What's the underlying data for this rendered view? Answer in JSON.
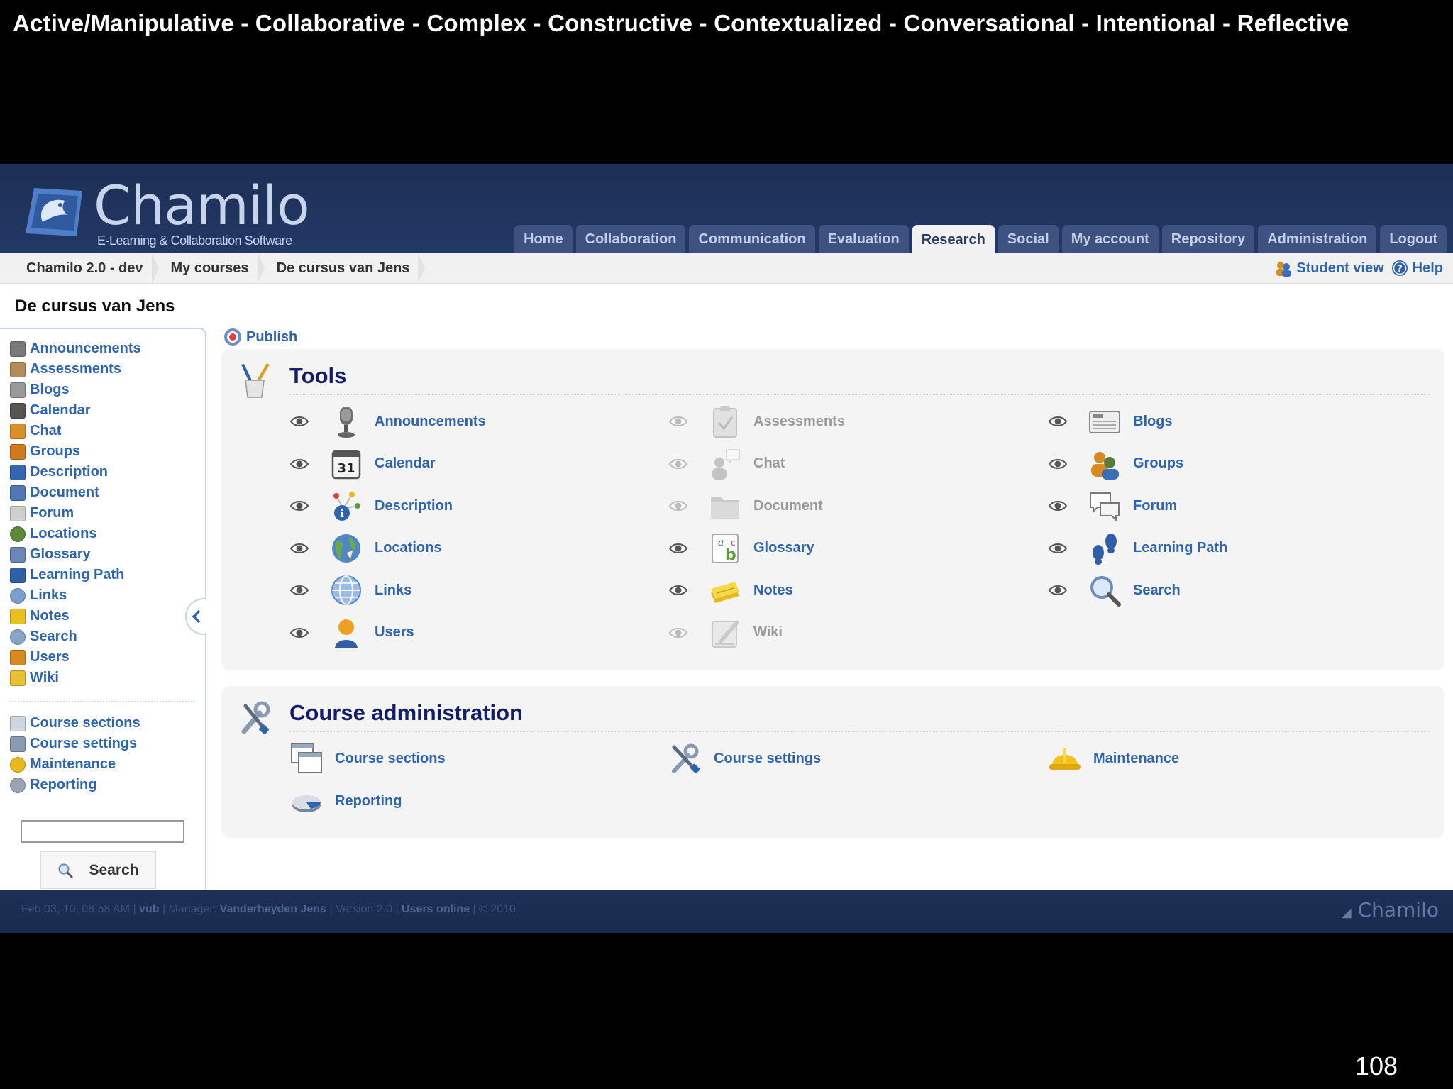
{
  "slide": {
    "title": "Active/Manipulative - Collaborative - Complex - Constructive - Contextualized - Conversational - Intentional - Reflective",
    "page_number": "108"
  },
  "header": {
    "logo_text": "Chamilo",
    "logo_sub": "E-Learning & Collaboration Software",
    "tabs": [
      {
        "label": "Home",
        "active": false
      },
      {
        "label": "Collaboration",
        "active": false
      },
      {
        "label": "Communication",
        "active": false
      },
      {
        "label": "Evaluation",
        "active": false
      },
      {
        "label": "Research",
        "active": true
      },
      {
        "label": "Social",
        "active": false
      },
      {
        "label": "My account",
        "active": false
      },
      {
        "label": "Repository",
        "active": false
      },
      {
        "label": "Administration",
        "active": false
      },
      {
        "label": "Logout",
        "active": false
      }
    ]
  },
  "breadcrumb": {
    "items": [
      "Chamilo 2.0 - dev",
      "My courses",
      "De cursus van Jens"
    ],
    "student_view": "Student view",
    "help": "Help"
  },
  "sidebar": {
    "course_title": "De cursus van Jens",
    "tools": [
      {
        "label": "Announcements",
        "icon": "announcements-icon",
        "color": "#7a7a7a"
      },
      {
        "label": "Assessments",
        "icon": "assessments-icon",
        "color": "#b58a5a"
      },
      {
        "label": "Blogs",
        "icon": "blogs-icon",
        "color": "#9a9a9a"
      },
      {
        "label": "Calendar",
        "icon": "calendar-icon",
        "color": "#555555"
      },
      {
        "label": "Chat",
        "icon": "chat-icon",
        "color": "#d8902a"
      },
      {
        "label": "Groups",
        "icon": "groups-icon",
        "color": "#d07a20"
      },
      {
        "label": "Description",
        "icon": "description-icon",
        "color": "#3566b0"
      },
      {
        "label": "Document",
        "icon": "document-icon",
        "color": "#4f78b5"
      },
      {
        "label": "Forum",
        "icon": "forum-icon",
        "color": "#cfcfcf"
      },
      {
        "label": "Locations",
        "icon": "locations-icon",
        "color": "#5a8a3a"
      },
      {
        "label": "Glossary",
        "icon": "glossary-icon",
        "color": "#6c86b8"
      },
      {
        "label": "Learning Path",
        "icon": "learning-path-icon",
        "color": "#2f5fa8"
      },
      {
        "label": "Links",
        "icon": "links-icon",
        "color": "#7aa0d0"
      },
      {
        "label": "Notes",
        "icon": "notes-icon",
        "color": "#e8c020"
      },
      {
        "label": "Search",
        "icon": "search-icon",
        "color": "#8aa4c8"
      },
      {
        "label": "Users",
        "icon": "users-icon",
        "color": "#d88a20"
      },
      {
        "label": "Wiki",
        "icon": "wiki-icon",
        "color": "#e8c030"
      }
    ],
    "admin": [
      {
        "label": "Course sections",
        "icon": "course-sections-icon",
        "color": "#cfd6e0"
      },
      {
        "label": "Course settings",
        "icon": "course-settings-icon",
        "color": "#8a9ab0"
      },
      {
        "label": "Maintenance",
        "icon": "maintenance-icon",
        "color": "#e8b820"
      },
      {
        "label": "Reporting",
        "icon": "reporting-icon",
        "color": "#9aa4b4"
      }
    ],
    "search_value": "",
    "search_button": "Search"
  },
  "main": {
    "publish_label": "Publish",
    "tools_title": "Tools",
    "tools": [
      {
        "label": "Announcements",
        "icon": "microphone-icon",
        "visible": true
      },
      {
        "label": "Assessments",
        "icon": "clipboard-icon",
        "visible": false
      },
      {
        "label": "Blogs",
        "icon": "news-icon",
        "visible": true
      },
      {
        "label": "Calendar",
        "icon": "calendar-icon",
        "visible": true
      },
      {
        "label": "Chat",
        "icon": "chat-icon",
        "visible": false
      },
      {
        "label": "Groups",
        "icon": "groups-icon",
        "visible": true
      },
      {
        "label": "Description",
        "icon": "info-icon",
        "visible": true
      },
      {
        "label": "Document",
        "icon": "folder-icon",
        "visible": false
      },
      {
        "label": "Forum",
        "icon": "forum-icon",
        "visible": true
      },
      {
        "label": "Locations",
        "icon": "globe-icon",
        "visible": true
      },
      {
        "label": "Glossary",
        "icon": "glossary-icon",
        "visible": true
      },
      {
        "label": "Learning Path",
        "icon": "footsteps-icon",
        "visible": true
      },
      {
        "label": "Links",
        "icon": "world-icon",
        "visible": true
      },
      {
        "label": "Notes",
        "icon": "notes-icon",
        "visible": true
      },
      {
        "label": "Search",
        "icon": "magnifier-icon",
        "visible": true
      },
      {
        "label": "Users",
        "icon": "user-icon",
        "visible": true
      },
      {
        "label": "Wiki",
        "icon": "wiki-icon",
        "visible": false
      }
    ],
    "admin_title": "Course administration",
    "admin_items": [
      {
        "label": "Course sections",
        "icon": "windows-icon"
      },
      {
        "label": "Course settings",
        "icon": "tools-icon"
      },
      {
        "label": "Maintenance",
        "icon": "hardhat-icon"
      },
      {
        "label": "Reporting",
        "icon": "pie-icon"
      }
    ]
  },
  "footer": {
    "date": "Feb 03, 10, 08:58 AM",
    "org": "vub",
    "manager_label": "Manager:",
    "manager": "Vanderheyden Jens",
    "version": "Version 2.0",
    "users_online": "Users online",
    "copyright": "© 2010",
    "logo": "Chamilo"
  },
  "colors": {
    "header_bg": "#1f3259",
    "link": "#2f64ad",
    "panel_title": "#131d68",
    "disabled": "#999999"
  }
}
